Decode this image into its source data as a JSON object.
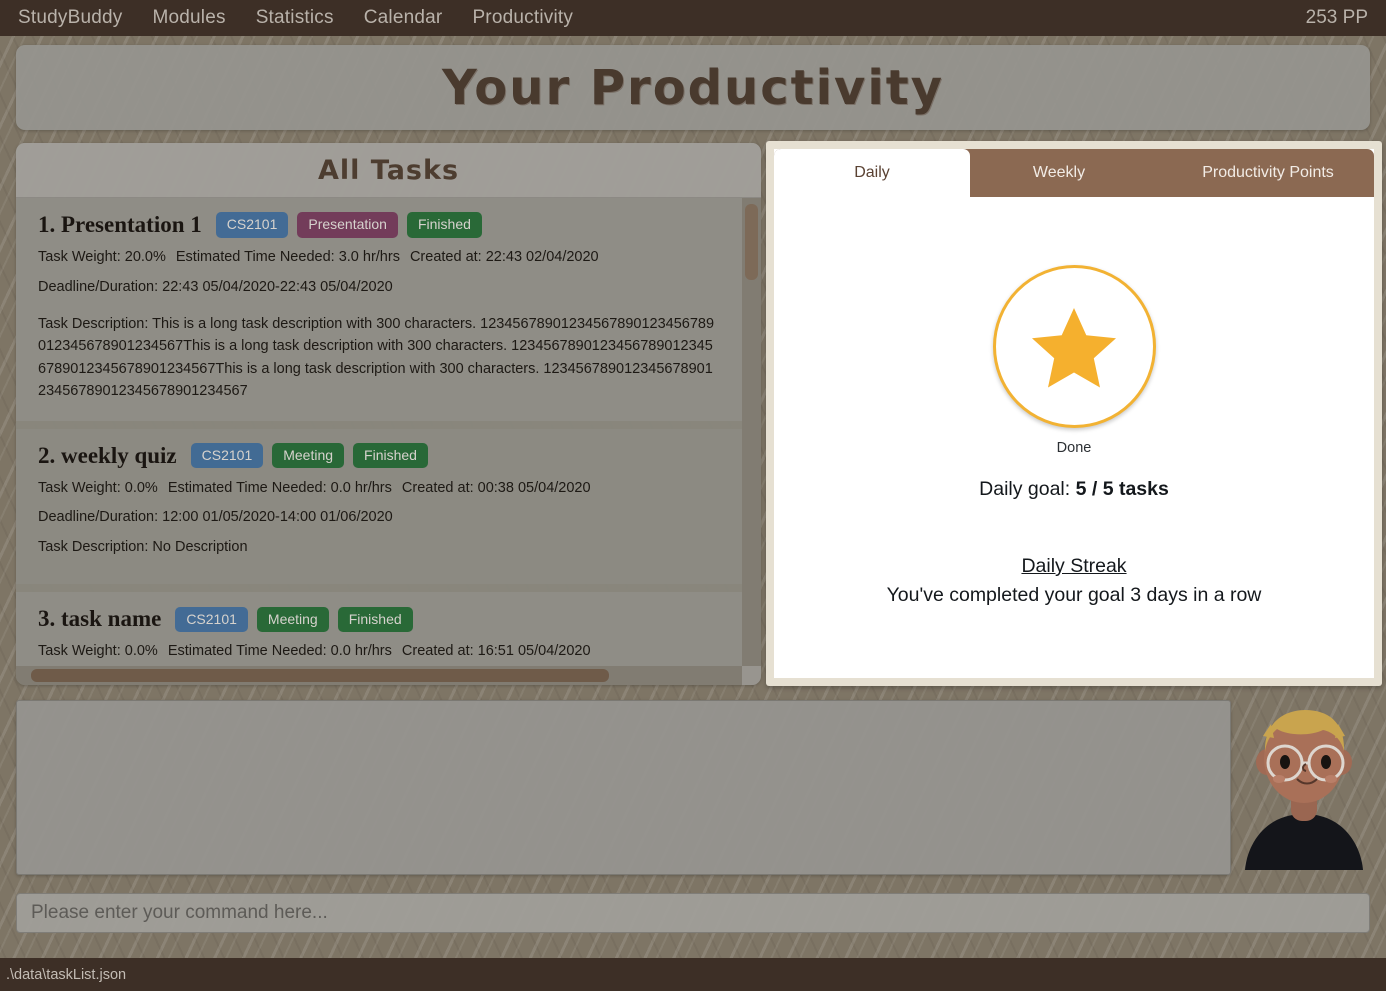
{
  "menubar": {
    "items": [
      {
        "label": "StudyBuddy"
      },
      {
        "label": "Modules"
      },
      {
        "label": "Statistics"
      },
      {
        "label": "Calendar"
      },
      {
        "label": "Productivity"
      }
    ],
    "points": "253 PP"
  },
  "header": {
    "title": "Your Productivity"
  },
  "tasklist": {
    "header": "All Tasks",
    "tasks": [
      {
        "title": "1.  Presentation 1",
        "tags": [
          {
            "label": "CS2101",
            "color": "#2f6398"
          },
          {
            "label": "Presentation",
            "color": "#6b284f"
          },
          {
            "label": "Finished",
            "color": "#166228"
          }
        ],
        "weight": "Task Weight: 20.0%",
        "estimated": "Estimated Time Needed: 3.0 hr/hrs",
        "created": "Created at: 22:43 02/04/2020",
        "deadline": "Deadline/Duration: 22:43 05/04/2020-22:43 05/04/2020",
        "description": "Task Description: This is a long task description with 300 characters. 12345678901234567890123456789012345678901234567This is a long task description with 300 characters. 12345678901234567890123456789012345678901234567This is a long task description with 300 characters. 12345678901234567890123456789012345678901234567"
      },
      {
        "title": "2.  weekly quiz",
        "tags": [
          {
            "label": "CS2101",
            "color": "#2f6398"
          },
          {
            "label": "Meeting",
            "color": "#166228"
          },
          {
            "label": "Finished",
            "color": "#166228"
          }
        ],
        "weight": "Task Weight: 0.0%",
        "estimated": "Estimated Time Needed: 0.0 hr/hrs",
        "created": "Created at: 00:38 05/04/2020",
        "deadline": "Deadline/Duration: 12:00 01/05/2020-14:00 01/06/2020",
        "description": "Task Description: No Description"
      },
      {
        "title": "3.  task name",
        "tags": [
          {
            "label": "CS2101",
            "color": "#2f6398"
          },
          {
            "label": "Meeting",
            "color": "#166228"
          },
          {
            "label": "Finished",
            "color": "#166228"
          }
        ],
        "weight": "Task Weight: 0.0%",
        "estimated": "Estimated Time Needed: 0.0 hr/hrs",
        "created": "Created at: 16:51 05/04/2020",
        "deadline": "",
        "description": ""
      }
    ]
  },
  "stats": {
    "tabs": [
      {
        "label": "Daily",
        "active": true
      },
      {
        "label": "Weekly",
        "active": false
      },
      {
        "label": "Productivity Points",
        "active": false
      }
    ],
    "badge": {
      "icon": "star-icon",
      "label": "Done",
      "star_color": "#f5b02e",
      "ring_color": "#f2b233"
    },
    "daily_goal_label": "Daily goal:",
    "daily_goal_value": "5 / 5 tasks",
    "streak_title": "Daily Streak",
    "streak_text": "You've completed your goal 3 days in a row"
  },
  "console": {
    "output": ""
  },
  "command": {
    "value": "",
    "placeholder": "Please enter your command here..."
  },
  "statusbar": {
    "path": ".\\data\\taskList.json"
  }
}
